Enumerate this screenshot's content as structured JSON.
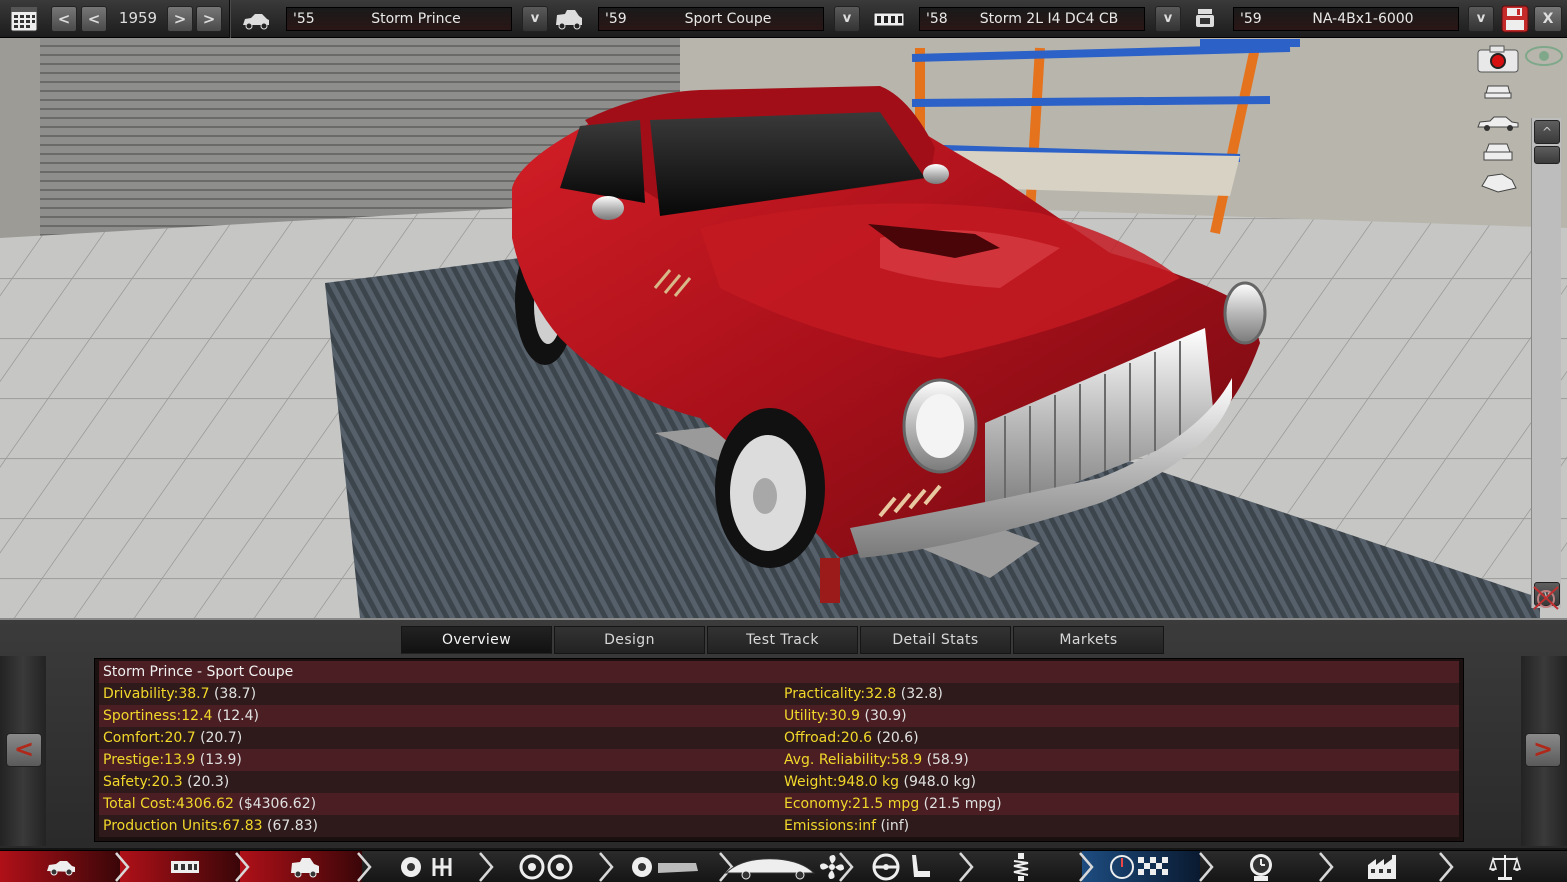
{
  "topbar": {
    "year": "1959",
    "calendar_icon": "calendar-icon",
    "prev_fast_label": "<",
    "prev_label": "<",
    "next_label": ">",
    "next_fast_label": ">",
    "dropdown_label": "v",
    "car_model": {
      "year": "'55",
      "name": "Storm Prince"
    },
    "trim": {
      "year": "'59",
      "name": "Sport Coupe"
    },
    "engine_family": {
      "year": "'58",
      "name": "Storm 2L I4 DC4 CB"
    },
    "engine_variant": {
      "year": "'59",
      "name": "NA-4Bx1-6000"
    },
    "save_icon": "save-icon",
    "close_label": "X"
  },
  "viewport_controls": {
    "camera_icon": "camera-icon",
    "view_icons": [
      "front-view-icon",
      "side-view-icon",
      "rear-view-icon",
      "top-view-icon"
    ],
    "eye_icon": "eye-icon",
    "scroll_up_label": "^",
    "scroll_down_label": "v"
  },
  "tabs": [
    {
      "label": "Overview",
      "active": true
    },
    {
      "label": "Design",
      "active": false
    },
    {
      "label": "Test Track",
      "active": false
    },
    {
      "label": "Detail Stats",
      "active": false
    },
    {
      "label": "Markets",
      "active": false
    }
  ],
  "overview": {
    "title": "Storm Prince - Sport Coupe",
    "left": [
      {
        "label": "Drivability:",
        "value": "38.7",
        "paren": "(38.7)"
      },
      {
        "label": "Sportiness:",
        "value": "12.4",
        "paren": "(12.4)"
      },
      {
        "label": "Comfort:",
        "value": "20.7",
        "paren": "(20.7)"
      },
      {
        "label": "Prestige:",
        "value": "13.9",
        "paren": "(13.9)"
      },
      {
        "label": "Safety:",
        "value": "20.3",
        "paren": "(20.3)"
      },
      {
        "label": "Total Cost:",
        "value": "4306.62",
        "paren": "($4306.62)"
      },
      {
        "label": "Production Units:",
        "value": "67.83",
        "paren": "(67.83)"
      }
    ],
    "right": [
      {
        "label": "Practicality:",
        "value": "32.8",
        "paren": "(32.8)"
      },
      {
        "label": "Utility:",
        "value": "30.9",
        "paren": "(30.9)"
      },
      {
        "label": "Offroad:",
        "value": "20.6",
        "paren": "(20.6)"
      },
      {
        "label": "Avg. Reliability:",
        "value": "58.9",
        "paren": "(58.9)"
      },
      {
        "label": "Weight:",
        "value": "948.0 kg",
        "paren": "(948.0 kg)"
      },
      {
        "label": "Economy:",
        "value": "21.5 mpg",
        "paren": "(21.5 mpg)"
      },
      {
        "label": "Emissions:",
        "value": "inf",
        "paren": "(inf)"
      }
    ],
    "prev_label": "<",
    "next_label": ">"
  },
  "bottom_nav": [
    "chassis-icon",
    "frame-icon",
    "body-icon",
    "engine-gearbox-icon",
    "wheels-icon",
    "body-design-icon",
    "aero-fan-icon",
    "interior-steering-icon",
    "suspension-icon",
    "testing-icon",
    "tuning-time-icon",
    "factory-icon",
    "balance-icon"
  ],
  "colors": {
    "car_paint": "#b5141c",
    "stat_yellow": "#f2d82a",
    "row_dark_red": "#4a1e23"
  }
}
